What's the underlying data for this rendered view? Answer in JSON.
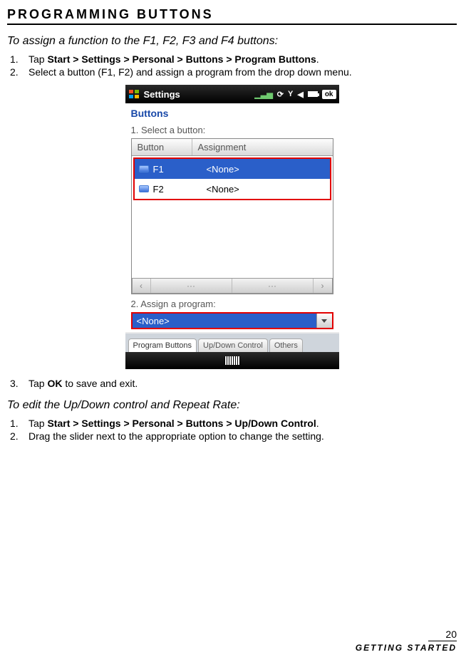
{
  "page": {
    "section_title": "Programming Buttons",
    "instruction_a_title": "To assign a function to the F1, F2, F3 and F4 buttons:",
    "step_a1_num": "1.",
    "step_a1_prefix": "Tap ",
    "step_a1_bold": "Start > Settings > Personal > Buttons > Program Buttons",
    "step_a1_suffix": ".",
    "step_a2_num": "2.",
    "step_a2_text": "Select a button (F1, F2) and assign a program from the drop down menu.",
    "step_a3_num": "3.",
    "step_a3_prefix": "Tap ",
    "step_a3_bold": "OK",
    "step_a3_suffix": " to save and exit.",
    "instruction_b_title": "To edit the Up/Down control and Repeat Rate:",
    "step_b1_num": "1.",
    "step_b1_prefix": "Tap ",
    "step_b1_bold": "Start > Settings > Personal > Buttons > Up/Down Control",
    "step_b1_suffix": ".",
    "step_b2_num": "2.",
    "step_b2_text": "Drag the slider next to the appropriate option to change the setting.",
    "footer_page_num": "20",
    "footer_label": "Getting Started"
  },
  "device": {
    "titlebar_label": "Settings",
    "ok_label": "ok",
    "pane_title": "Buttons",
    "label_select": "1. Select a button:",
    "th_button": "Button",
    "th_assignment": "Assignment",
    "rows": [
      {
        "name": "F1",
        "assignment": "<None>",
        "selected": true
      },
      {
        "name": "F2",
        "assignment": "<None>",
        "selected": false
      }
    ],
    "scroll_left": "‹",
    "scroll_right": "›",
    "label_assign": "2. Assign a program:",
    "dropdown_value": "<None>",
    "tabs": [
      {
        "label": "Program Buttons",
        "active": true
      },
      {
        "label": "Up/Down Control",
        "active": false
      },
      {
        "label": "Others",
        "active": false
      }
    ]
  }
}
